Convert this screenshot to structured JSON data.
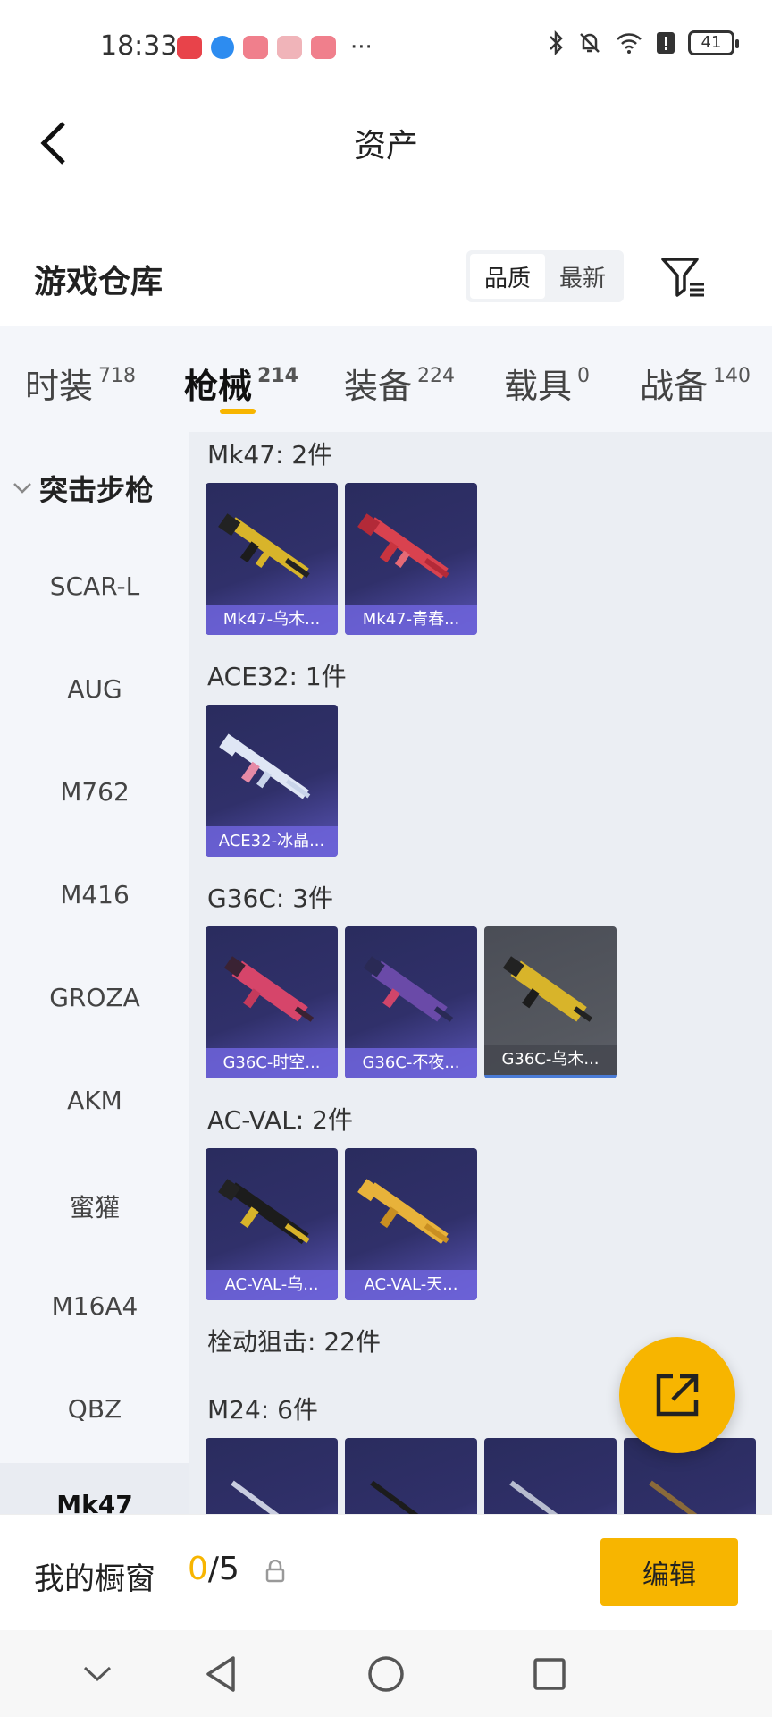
{
  "status_bar": {
    "time": "18:33",
    "more": "···",
    "battery": "41"
  },
  "header": {
    "title": "资产"
  },
  "warehouse": {
    "title": "游戏仓库",
    "sort_options": [
      "品质",
      "最新"
    ],
    "active_sort": "品质"
  },
  "tabs": [
    {
      "label": "时装",
      "count": "718"
    },
    {
      "label": "枪械",
      "count": "214"
    },
    {
      "label": "装备",
      "count": "224"
    },
    {
      "label": "载具",
      "count": "0"
    },
    {
      "label": "战备",
      "count": "140"
    }
  ],
  "active_tab": "枪械",
  "sidebar": {
    "category": "突击步枪",
    "items": [
      "SCAR-L",
      "AUG",
      "M762",
      "M416",
      "GROZA",
      "AKM",
      "蜜獾",
      "M16A4",
      "QBZ",
      "Mk47"
    ]
  },
  "groups": [
    {
      "title": "Mk47: 2件",
      "items": [
        "Mk47-乌木...",
        "Mk47-青春..."
      ]
    },
    {
      "title": "ACE32: 1件",
      "items": [
        "ACE32-冰晶..."
      ]
    },
    {
      "title": "G36C: 3件",
      "items": [
        "G36C-时空...",
        "G36C-不夜...",
        "G36C-乌木..."
      ]
    },
    {
      "title": "AC-VAL: 2件",
      "items": [
        "AC-VAL-乌...",
        "AC-VAL-天..."
      ]
    }
  ],
  "sniper_section": "栓动狙击: 22件",
  "m24_group": "M24: 6件",
  "bottom": {
    "showcase_label": "我的橱窗",
    "showcase_used": "0",
    "showcase_total": "/5",
    "edit_label": "编辑"
  },
  "colors": {
    "accent": "#f7b500",
    "card_purple": "#30306a"
  }
}
